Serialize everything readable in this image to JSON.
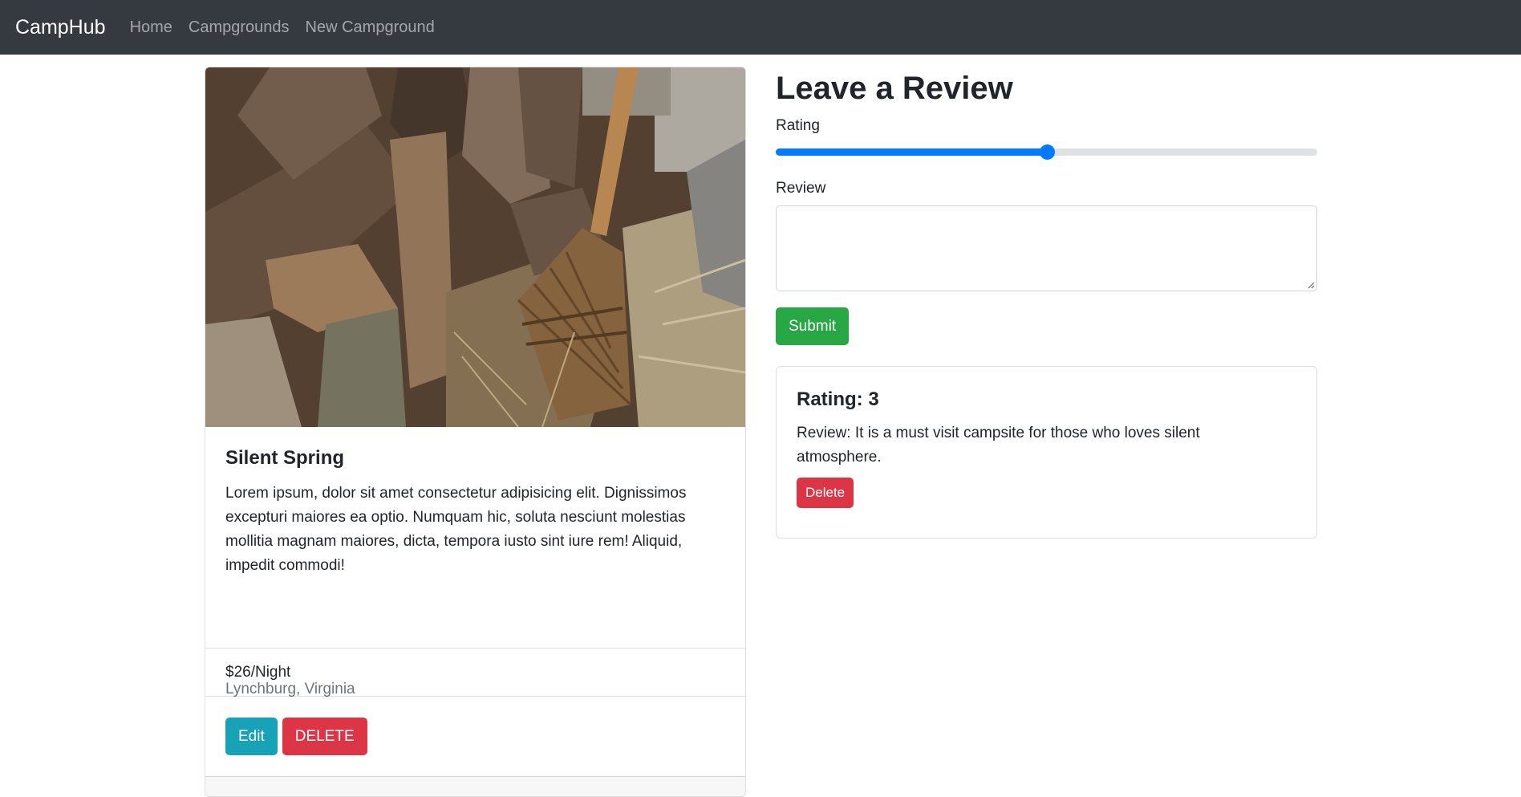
{
  "navbar": {
    "brand": "CampHub",
    "links": [
      "Home",
      "Campgrounds",
      "New Campground"
    ]
  },
  "campground": {
    "title": "Silent Spring",
    "description": "Lorem ipsum, dolor sit amet consectetur adipisicing elit. Dignissimos excepturi maiores ea optio. Numquam hic, soluta nesciunt molestias mollitia magnam maiores, dicta, tempora iusto sint iure rem! Aliquid, impedit commodi!",
    "location": "Lynchburg, Virginia",
    "price": "$26/Night",
    "edit_label": "Edit",
    "delete_label": "DELETE"
  },
  "review_form": {
    "heading": "Leave a Review",
    "rating_label": "Rating",
    "rating_value": 3,
    "rating_min": 1,
    "rating_max": 5,
    "review_label": "Review",
    "review_value": "",
    "submit_label": "Submit"
  },
  "reviews": [
    {
      "title": "Rating: 3",
      "text": "Review: It is a must visit campsite for those who loves silent atmosphere.",
      "delete_label": "Delete"
    }
  ],
  "colors": {
    "navbar": "#343a40",
    "primary": "#007bff",
    "info": "#17a2b8",
    "danger": "#dc3545",
    "success": "#28a745"
  }
}
